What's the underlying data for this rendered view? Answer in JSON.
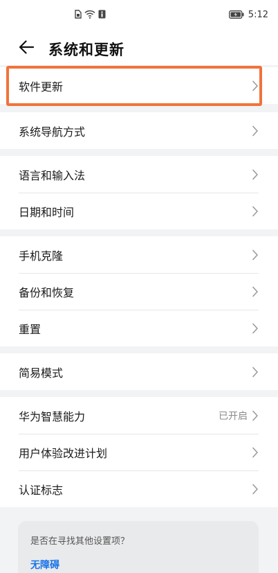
{
  "status_bar": {
    "time": "5:12",
    "icons": [
      "sim-card-icon",
      "wifi-icon",
      "notification-icon",
      "battery-charging-icon"
    ]
  },
  "header": {
    "back_icon": "arrow-left-icon",
    "title": "系统和更新"
  },
  "groups": [
    {
      "items": [
        {
          "label": "软件更新",
          "highlighted": true
        }
      ]
    },
    {
      "items": [
        {
          "label": "系统导航方式"
        }
      ]
    },
    {
      "items": [
        {
          "label": "语言和输入法"
        },
        {
          "label": "日期和时间"
        }
      ]
    },
    {
      "items": [
        {
          "label": "手机克隆"
        },
        {
          "label": "备份和恢复"
        },
        {
          "label": "重置"
        }
      ]
    },
    {
      "items": [
        {
          "label": "简易模式"
        }
      ]
    },
    {
      "items": [
        {
          "label": "华为智慧能力",
          "value": "已开启"
        },
        {
          "label": "用户体验改进计划"
        },
        {
          "label": "认证标志"
        }
      ]
    }
  ],
  "suggestion": {
    "question": "是否在寻找其他设置项？",
    "link": "无障碍"
  },
  "colors": {
    "background": "#f1f3f5",
    "card": "#ffffff",
    "highlight": "#f0733b",
    "link": "#1a73e8"
  }
}
